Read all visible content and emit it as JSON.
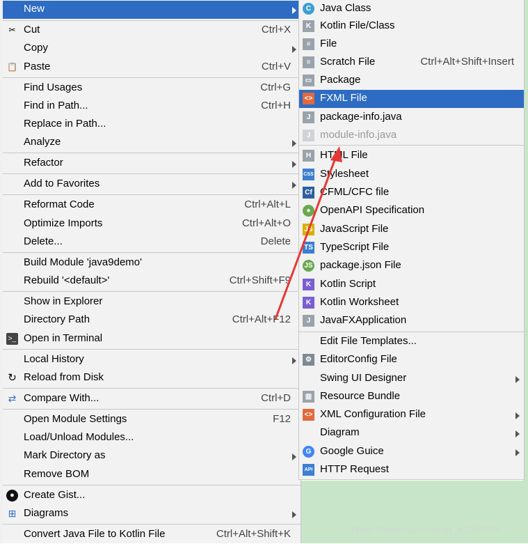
{
  "main_menu": [
    {
      "label": "New",
      "shortcut": "",
      "submenu": true,
      "selected": true
    },
    {
      "label": "Cut",
      "shortcut": "Ctrl+X",
      "icon": "scissors-icon"
    },
    {
      "label": "Copy",
      "shortcut": "",
      "submenu": true
    },
    {
      "label": "Paste",
      "shortcut": "Ctrl+V",
      "icon": "clipboard-icon"
    },
    {
      "label": "Find Usages",
      "shortcut": "Ctrl+G"
    },
    {
      "label": "Find in Path...",
      "shortcut": "Ctrl+H"
    },
    {
      "label": "Replace in Path...",
      "shortcut": ""
    },
    {
      "label": "Analyze",
      "shortcut": "",
      "submenu": true
    },
    {
      "label": "Refactor",
      "shortcut": "",
      "submenu": true
    },
    {
      "label": "Add to Favorites",
      "shortcut": "",
      "submenu": true
    },
    {
      "label": "Reformat Code",
      "shortcut": "Ctrl+Alt+L"
    },
    {
      "label": "Optimize Imports",
      "shortcut": "Ctrl+Alt+O"
    },
    {
      "label": "Delete...",
      "shortcut": "Delete"
    },
    {
      "label": "Build Module 'java9demo'",
      "shortcut": ""
    },
    {
      "label": "Rebuild '<default>'",
      "shortcut": "Ctrl+Shift+F9"
    },
    {
      "label": "Show in Explorer",
      "shortcut": ""
    },
    {
      "label": "Directory Path",
      "shortcut": "Ctrl+Alt+F12"
    },
    {
      "label": "Open in Terminal",
      "shortcut": "",
      "icon": "terminal-icon"
    },
    {
      "label": "Local History",
      "shortcut": "",
      "submenu": true
    },
    {
      "label": "Reload from Disk",
      "shortcut": "",
      "icon": "reload-icon"
    },
    {
      "label": "Compare With...",
      "shortcut": "Ctrl+D",
      "icon": "compare-icon"
    },
    {
      "label": "Open Module Settings",
      "shortcut": "F12"
    },
    {
      "label": "Load/Unload Modules...",
      "shortcut": ""
    },
    {
      "label": "Mark Directory as",
      "shortcut": "",
      "submenu": true
    },
    {
      "label": "Remove BOM",
      "shortcut": ""
    },
    {
      "label": "Create Gist...",
      "shortcut": "",
      "icon": "github-icon"
    },
    {
      "label": "Diagrams",
      "shortcut": "",
      "submenu": true,
      "icon": "diagram-icon"
    },
    {
      "label": "Convert Java File to Kotlin File",
      "shortcut": "Ctrl+Alt+Shift+K"
    }
  ],
  "submenu": [
    {
      "label": "Java Class",
      "shortcut": "",
      "icon": "java-class-icon",
      "glyph": "C",
      "color": "#3d9fd1",
      "round": true
    },
    {
      "label": "Kotlin File/Class",
      "shortcut": "",
      "icon": "kotlin-file-icon",
      "glyph": "K",
      "color": "#9aa3ab"
    },
    {
      "label": "File",
      "shortcut": "",
      "icon": "file-icon",
      "glyph": "≡",
      "color": "#9aa3ab"
    },
    {
      "label": "Scratch File",
      "shortcut": "Ctrl+Alt+Shift+Insert",
      "icon": "scratch-file-icon",
      "glyph": "≡",
      "color": "#9aa3ab"
    },
    {
      "label": "Package",
      "shortcut": "",
      "icon": "package-icon",
      "glyph": "▭",
      "color": "#9aa3ab"
    },
    {
      "label": "FXML File",
      "shortcut": "",
      "icon": "fxml-file-icon",
      "glyph": "<>",
      "color": "#e06a3c",
      "selected": true
    },
    {
      "label": "package-info.java",
      "shortcut": "",
      "icon": "java-file-icon",
      "glyph": "J",
      "color": "#9aa3ab"
    },
    {
      "label": "module-info.java",
      "shortcut": "",
      "icon": "java-file-icon",
      "glyph": "J",
      "color": "#cfd3d7",
      "disabled": true
    },
    {
      "label": "HTML File",
      "shortcut": "",
      "icon": "html-file-icon",
      "glyph": "H",
      "color": "#9aa3ab"
    },
    {
      "label": "Stylesheet",
      "shortcut": "",
      "icon": "css-file-icon",
      "glyph": "CSS",
      "color": "#3d7fd1"
    },
    {
      "label": "CFML/CFC file",
      "shortcut": "",
      "icon": "cfml-file-icon",
      "glyph": "Cf",
      "color": "#2f5f9f"
    },
    {
      "label": "OpenAPI Specification",
      "shortcut": "",
      "icon": "openapi-icon",
      "glyph": "●",
      "color": "#6aa84f",
      "round": true
    },
    {
      "label": "JavaScript File",
      "shortcut": "",
      "icon": "javascript-file-icon",
      "glyph": "JS",
      "color": "#d9b000"
    },
    {
      "label": "TypeScript File",
      "shortcut": "",
      "icon": "typescript-file-icon",
      "glyph": "TS",
      "color": "#3d7fd1"
    },
    {
      "label": "package.json File",
      "shortcut": "",
      "icon": "nodejs-icon",
      "glyph": "JS",
      "color": "#6aa84f",
      "round": true
    },
    {
      "label": "Kotlin Script",
      "shortcut": "",
      "icon": "kotlin-script-icon",
      "glyph": "K",
      "color": "#7b5fd1"
    },
    {
      "label": "Kotlin Worksheet",
      "shortcut": "",
      "icon": "kotlin-worksheet-icon",
      "glyph": "K",
      "color": "#7b5fd1"
    },
    {
      "label": "JavaFXApplication",
      "shortcut": "",
      "icon": "java-file-icon",
      "glyph": "J",
      "color": "#9aa3ab"
    },
    {
      "label": "Edit File Templates...",
      "shortcut": ""
    },
    {
      "label": "EditorConfig File",
      "shortcut": "",
      "icon": "gear-icon",
      "glyph": "⚙",
      "color": "#7f8a94"
    },
    {
      "label": "Swing UI Designer",
      "shortcut": "",
      "submenu": true
    },
    {
      "label": "Resource Bundle",
      "shortcut": "",
      "icon": "resource-bundle-icon",
      "glyph": "▥",
      "color": "#9aa3ab"
    },
    {
      "label": "XML Configuration File",
      "shortcut": "",
      "submenu": true,
      "icon": "xml-file-icon",
      "glyph": "<>",
      "color": "#e06a3c"
    },
    {
      "label": "Diagram",
      "shortcut": "",
      "submenu": true
    },
    {
      "label": "Google Guice",
      "shortcut": "",
      "submenu": true,
      "icon": "google-icon",
      "glyph": "G",
      "color": "#4285f4",
      "round": true
    },
    {
      "label": "HTTP Request",
      "shortcut": "",
      "icon": "api-icon",
      "glyph": "API",
      "color": "#3d7fd1"
    }
  ],
  "watermark": "https://blog.csdn.net/qq_41890624"
}
